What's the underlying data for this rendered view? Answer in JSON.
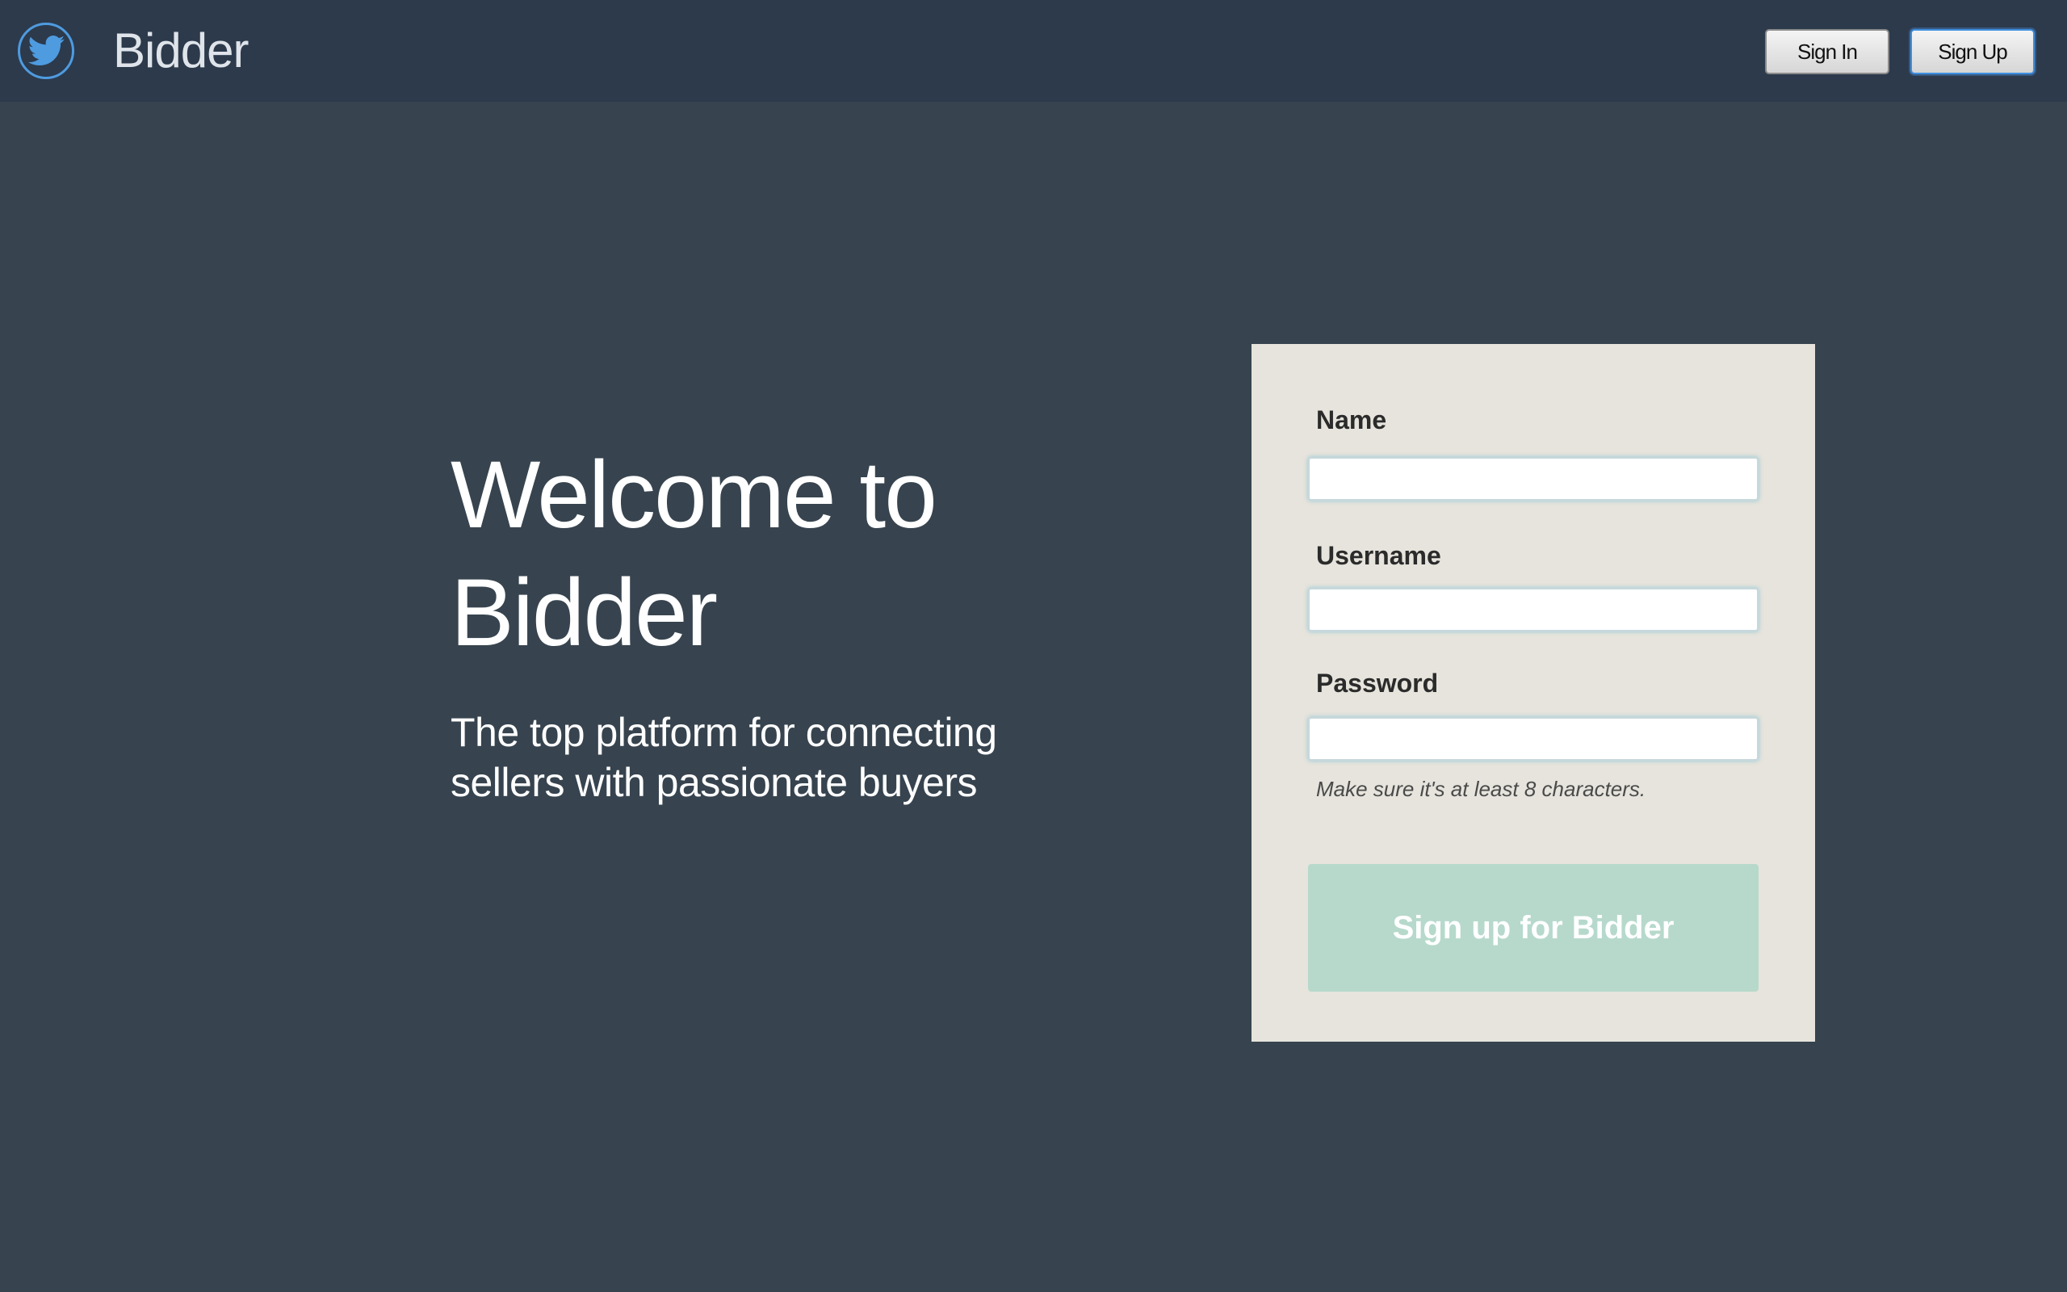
{
  "header": {
    "brand": "Bidder",
    "logo_icon": "bird-icon",
    "sign_in_label": "Sign In",
    "sign_up_label": "Sign Up"
  },
  "hero": {
    "title_line1": "Welcome to",
    "title_line2": "Bidder",
    "subtitle_line1": "The top platform for connecting",
    "subtitle_line2": "sellers with passionate buyers"
  },
  "form": {
    "name_label": "Name",
    "name_value": "",
    "username_label": "Username",
    "username_value": "",
    "password_label": "Password",
    "password_value": "",
    "password_hint": "Make sure it's at least 8 characters.",
    "submit_label": "Sign up for Bidder"
  },
  "colors": {
    "background": "#37444f",
    "topbar": "#2c3a4c",
    "card": "#e6e4dc",
    "accent_button": "#b6d9cb",
    "logo": "#4e9be0"
  }
}
